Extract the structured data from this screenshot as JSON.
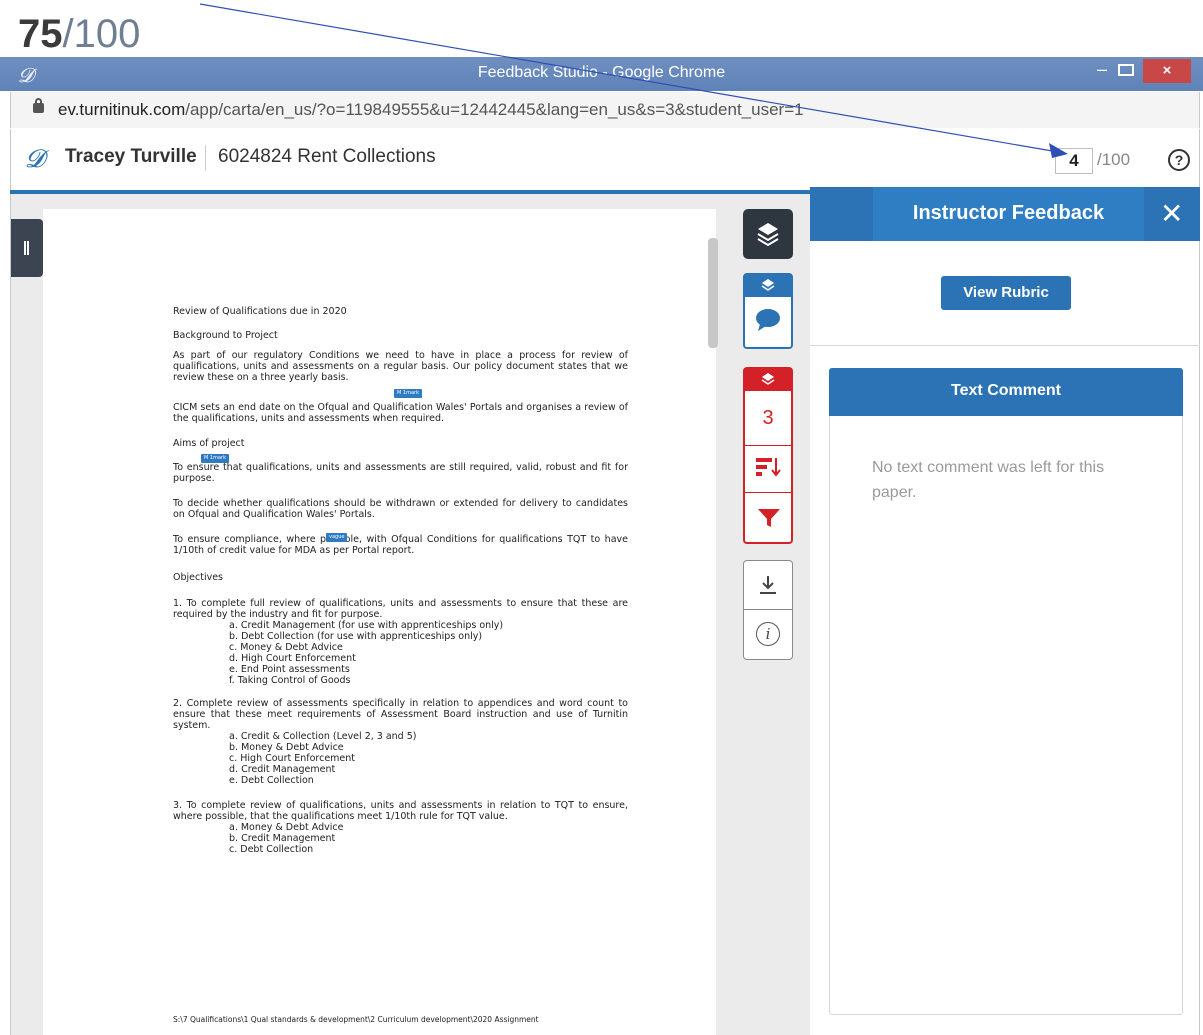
{
  "score_banner": {
    "value": "75",
    "denominator": "/100"
  },
  "window": {
    "title": "Feedback Studio - Google Chrome",
    "close_symbol": "×",
    "minimize_symbol": "–"
  },
  "address": {
    "host": "ev.turnitinuk.com",
    "path": "/app/carta/en_us/?o=119849555&u=12442445&lang=en_us&s=3&student_user=1"
  },
  "header": {
    "student": "Tracey Turville",
    "paper": "6024824 Rent Collections",
    "grade": "4",
    "grade_max": "/100",
    "help": "?"
  },
  "toolbar": {
    "flag_count": "3",
    "info": "i"
  },
  "panel": {
    "title": "Instructor Feedback",
    "close": "✕",
    "rubric_button": "View Rubric",
    "comment_title": "Text Comment",
    "comment_empty": "No text comment was left for this paper."
  },
  "document": {
    "title": "Review of Qualifications due in 2020",
    "background_heading": "Background to Project",
    "para1": "As part of our regulatory Conditions we need to have in place a process for review of qualifications, units and assessments on a regular basis. Our policy document states that we review these on a three yearly basis.",
    "para2": "CICM sets an end date on the Ofqual and Qualification Wales' Portals and organises a review of the qualifications, units and assessments when required.",
    "aims_heading": "Aims of project",
    "aim1": "To ensure that qualifications, units and assessments are still required, valid, robust and fit for purpose.",
    "aim2": "To decide whether qualifications should be withdrawn or extended for delivery to candidates on Ofqual and Qualification Wales' Portals.",
    "aim3": "To ensure compliance, where possible, with Ofqual Conditions for qualifications TQT to have 1/10th of credit value for MDA as per Portal report.",
    "objectives_heading": "Objectives",
    "obj1": "1.  To complete full review of qualifications, units and assessments to ensure that these are required by the industry and fit for purpose.",
    "obj1_items": [
      "a.  Credit Management  (for use with apprenticeships only)",
      "b.  Debt Collection  (for use with apprenticeships only)",
      "c.  Money & Debt Advice",
      "d.  High Court Enforcement",
      "e.  End Point assessments",
      "f.   Taking Control of Goods"
    ],
    "obj2": "2.  Complete review of assessments specifically in relation to appendices and word count to ensure that these meet requirements of Assessment Board instruction and use of Turnitin system.",
    "obj2_items": [
      "a.  Credit & Collection (Level 2, 3 and 5)",
      "b.  Money & Debt Advice",
      "c.  High Court Enforcement",
      "d.  Credit Management",
      "e.  Debt Collection"
    ],
    "obj3": "3.  To complete review of qualifications, units and assessments in relation to TQT to ensure, where possible, that the qualifications meet 1/10th rule for TQT value.",
    "obj3_items": [
      "a.  Money & Debt Advice",
      "b.  Credit Management",
      "c.  Debt Collection"
    ],
    "footer_path": "S:\\7 Qualifications\\1 Qual standards & development\\2 Curriculum development\\2020 Assignment",
    "tags": [
      "M 1mark",
      "M 1mark",
      "vague"
    ]
  },
  "colors": {
    "accent_blue": "#2b73b5",
    "flag_red": "#d42127",
    "chrome_blue": "#6f8fbf",
    "arrow": "#2f4fb5"
  },
  "icons": [
    "lock-icon",
    "turnitin-logo-icon",
    "help-icon",
    "layers-icon",
    "comment-icon",
    "flag-icon",
    "sort-icon",
    "filter-icon",
    "download-icon",
    "info-icon",
    "close-icon"
  ]
}
